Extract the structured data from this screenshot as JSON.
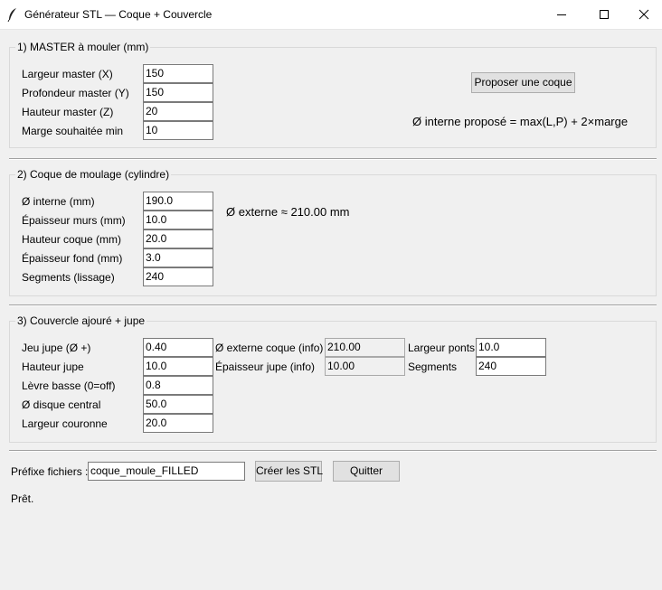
{
  "window": {
    "title": "Générateur STL — Coque + Couvercle",
    "icon": "feather-icon",
    "controls": [
      "minimize-icon",
      "maximize-icon",
      "close-icon"
    ]
  },
  "master": {
    "title": "1) MASTER à mouler (mm)",
    "fields": [
      {
        "label": "Largeur master (X)",
        "value": "150"
      },
      {
        "label": "Profondeur master (Y)",
        "value": "150"
      },
      {
        "label": "Hauteur master (Z)",
        "value": "20"
      },
      {
        "label": "Marge souhaitée min",
        "value": "10"
      }
    ],
    "propose_button": "Proposer une coque",
    "formula": "Ø interne proposé = max(L,P) + 2×marge"
  },
  "shell": {
    "title": "2) Coque de moulage (cylindre)",
    "fields": [
      {
        "label": "Ø interne (mm)",
        "value": "190.0"
      },
      {
        "label": "Épaisseur murs (mm)",
        "value": "10.0"
      },
      {
        "label": "Hauteur coque (mm)",
        "value": "20.0"
      },
      {
        "label": "Épaisseur fond (mm)",
        "value": "3.0"
      },
      {
        "label": "Segments (lissage)",
        "value": "240"
      }
    ],
    "external_info": "Ø externe ≈ 210.00 mm"
  },
  "lid": {
    "title": "3) Couvercle ajouré + jupe",
    "fields": [
      {
        "label": "Jeu jupe (Ø +)",
        "value": "0.40"
      },
      {
        "label": "Hauteur jupe",
        "value": "10.0"
      },
      {
        "label": "Lèvre basse (0=off)",
        "value": "0.8"
      },
      {
        "label": "Ø disque central",
        "value": "50.0"
      },
      {
        "label": "Largeur couronne",
        "value": "20.0"
      }
    ],
    "info_fields": [
      {
        "label": "Ø externe coque (info)",
        "value": "210.00"
      },
      {
        "label": "Épaisseur jupe (info)",
        "value": "10.00"
      }
    ],
    "extra_fields": [
      {
        "label": "Largeur ponts",
        "value": "10.0"
      },
      {
        "label": "Segments",
        "value": "240"
      }
    ]
  },
  "footer": {
    "prefix_label": "Préfixe fichiers :",
    "prefix_value": "coque_moule_FILLED",
    "create_button": "Créer les STL",
    "quit_button": "Quitter",
    "status": "Prêt."
  }
}
